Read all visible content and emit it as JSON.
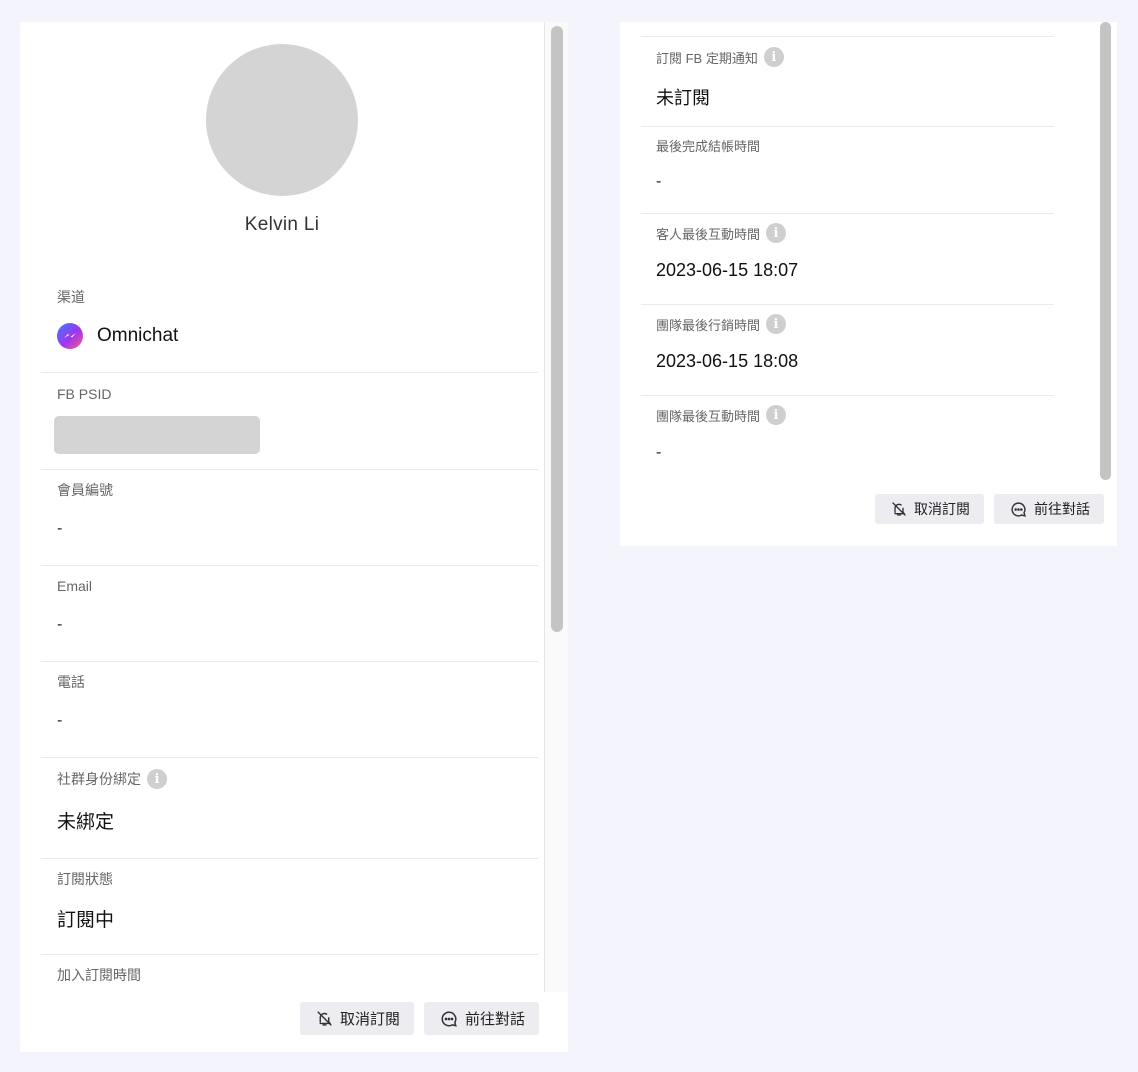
{
  "profile": {
    "name": "Kelvin Li"
  },
  "left_panel": {
    "fields": {
      "channel": {
        "label": "渠道",
        "value": "Omnichat",
        "icon": "messenger-icon"
      },
      "fb_psid": {
        "label": "FB PSID"
      },
      "member_id": {
        "label": "會員編號",
        "value": "-"
      },
      "email": {
        "label": "Email",
        "value": "-"
      },
      "phone": {
        "label": "電話",
        "value": "-"
      },
      "social_binding": {
        "label": "社群身份綁定",
        "value": "未綁定"
      },
      "subscription_status": {
        "label": "訂閱狀態",
        "value": "訂閱中"
      },
      "subscribe_time": {
        "label": "加入訂閱時間"
      }
    },
    "buttons": {
      "unsubscribe": "取消訂閱",
      "go_chat": "前往對話"
    }
  },
  "right_panel": {
    "fields": {
      "fb_recurring": {
        "label": "訂閱 FB 定期通知",
        "value": "未訂閱"
      },
      "last_checkout": {
        "label": "最後完成結帳時間",
        "value": "-"
      },
      "customer_last_interaction": {
        "label": "客人最後互動時間",
        "value": "2023-06-15 18:07"
      },
      "team_last_marketing": {
        "label": "團隊最後行銷時間",
        "value": "2023-06-15 18:08"
      },
      "team_last_interaction": {
        "label": "團隊最後互動時間",
        "value": "-"
      }
    },
    "buttons": {
      "unsubscribe": "取消訂閱",
      "go_chat": "前往對話"
    }
  },
  "icons": {
    "info": "info-icon",
    "bell_off": "bell-off-icon",
    "chat": "chat-bubble-icon"
  },
  "colors": {
    "page_bg": "#f4f5fc",
    "panel_bg": "#ffffff",
    "placeholder": "#d4d4d4",
    "button_bg": "#ececf1"
  }
}
